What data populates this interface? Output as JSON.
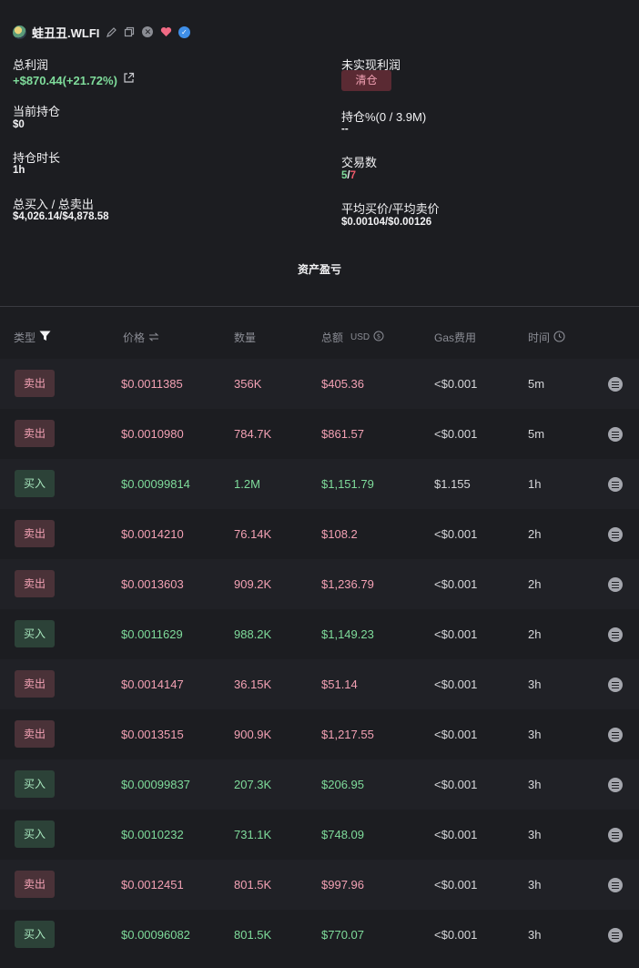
{
  "header": {
    "token_name": "蛙丑丑.WLFI"
  },
  "stats": {
    "total_profit_label": "总利润",
    "total_profit_value": "+$870.44(+21.72%)",
    "unrealized_label": "未实现利润",
    "clear_label": "清仓",
    "current_position_label": "当前持仓",
    "current_position_value": "$0",
    "holding_pct_label": "持仓%(0 / 3.9M)",
    "holding_pct_value": "--",
    "holding_duration_label": "持仓时长",
    "holding_duration_value": "1h",
    "trade_count_label": "交易数",
    "trade_count_buy": "5",
    "trade_count_sep": "/",
    "trade_count_sell": "7",
    "buy_sell_total_label": "总买入 / 总卖出",
    "buy_sell_total_value": "$4,026.14/$4,878.58",
    "avg_price_label": "平均买价/平均卖价",
    "avg_price_value": "$0.00104/$0.00126"
  },
  "section_title": "资产盈亏",
  "table": {
    "headers": {
      "type": "类型",
      "price": "价格",
      "qty": "数量",
      "total": "总额",
      "total_unit": "USD",
      "gas": "Gas费用",
      "time": "时间"
    },
    "rows": [
      {
        "type": "卖出",
        "side": "sell",
        "price": "$0.0011385",
        "qty": "356K",
        "total": "$405.36",
        "gas": "<$0.001",
        "time": "5m"
      },
      {
        "type": "卖出",
        "side": "sell",
        "price": "$0.0010980",
        "qty": "784.7K",
        "total": "$861.57",
        "gas": "<$0.001",
        "time": "5m"
      },
      {
        "type": "买入",
        "side": "buy",
        "price": "$0.00099814",
        "qty": "1.2M",
        "total": "$1,151.79",
        "gas": "$1.155",
        "time": "1h"
      },
      {
        "type": "卖出",
        "side": "sell",
        "price": "$0.0014210",
        "qty": "76.14K",
        "total": "$108.2",
        "gas": "<$0.001",
        "time": "2h"
      },
      {
        "type": "卖出",
        "side": "sell",
        "price": "$0.0013603",
        "qty": "909.2K",
        "total": "$1,236.79",
        "gas": "<$0.001",
        "time": "2h"
      },
      {
        "type": "买入",
        "side": "buy",
        "price": "$0.0011629",
        "qty": "988.2K",
        "total": "$1,149.23",
        "gas": "<$0.001",
        "time": "2h"
      },
      {
        "type": "卖出",
        "side": "sell",
        "price": "$0.0014147",
        "qty": "36.15K",
        "total": "$51.14",
        "gas": "<$0.001",
        "time": "3h"
      },
      {
        "type": "卖出",
        "side": "sell",
        "price": "$0.0013515",
        "qty": "900.9K",
        "total": "$1,217.55",
        "gas": "<$0.001",
        "time": "3h"
      },
      {
        "type": "买入",
        "side": "buy",
        "price": "$0.00099837",
        "qty": "207.3K",
        "total": "$206.95",
        "gas": "<$0.001",
        "time": "3h"
      },
      {
        "type": "买入",
        "side": "buy",
        "price": "$0.0010232",
        "qty": "731.1K",
        "total": "$748.09",
        "gas": "<$0.001",
        "time": "3h"
      },
      {
        "type": "卖出",
        "side": "sell",
        "price": "$0.0012451",
        "qty": "801.5K",
        "total": "$997.96",
        "gas": "<$0.001",
        "time": "3h"
      },
      {
        "type": "买入",
        "side": "buy",
        "price": "$0.00096082",
        "qty": "801.5K",
        "total": "$770.07",
        "gas": "<$0.001",
        "time": "3h"
      }
    ]
  },
  "colors": {
    "background": "#1c1d21",
    "buy": "#7fdc9b",
    "sell": "#f3a1b4",
    "sell_button_bg": "#4a3238",
    "buy_button_bg": "#2c4238",
    "clear_button_bg": "#5a2a33"
  },
  "icons": {
    "title_icons": [
      "edit-icon",
      "copy-icon",
      "x-social-icon",
      "heart-icon",
      "verified-badge-icon"
    ],
    "share": "external-link-icon",
    "filter": "filter-icon",
    "sort": "swap-icon",
    "currency_toggle": "currency-toggle-icon",
    "clock": "clock-icon",
    "detail": "detail-menu-icon"
  }
}
